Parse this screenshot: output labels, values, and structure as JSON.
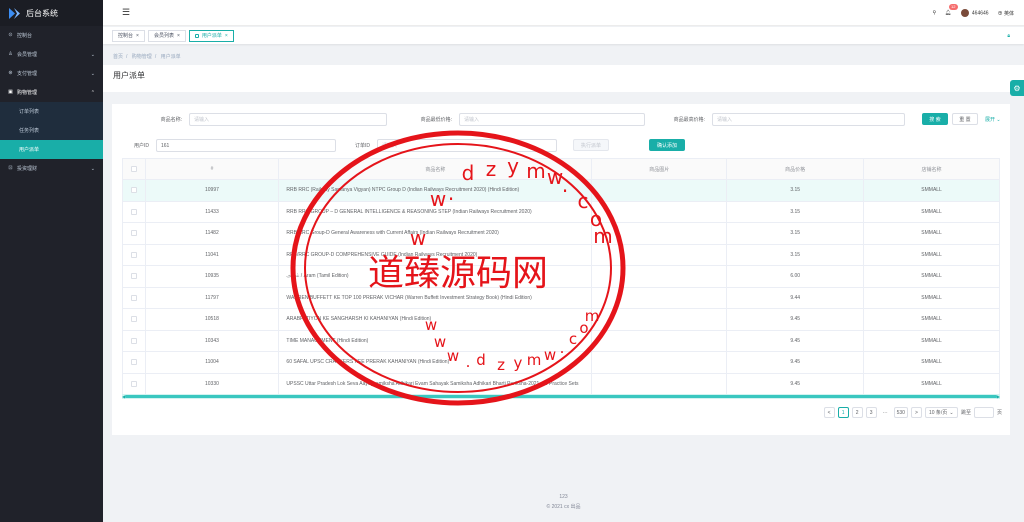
{
  "app": {
    "title": "后台系统"
  },
  "sidebar": {
    "items": [
      {
        "label": "控制台",
        "icon": "home-icon"
      },
      {
        "label": "会员管理",
        "icon": "user-icon",
        "arrow": "⌄"
      },
      {
        "label": "支付管理",
        "icon": "pay-icon",
        "arrow": "⌄"
      },
      {
        "label": "购物管理",
        "icon": "cart-icon",
        "arrow": "⌃"
      },
      {
        "label": "投资理财",
        "icon": "invest-icon",
        "arrow": "⌄"
      }
    ],
    "sub_items": [
      {
        "label": "订单列表"
      },
      {
        "label": "任务列表"
      },
      {
        "label": "用户派单"
      }
    ]
  },
  "header": {
    "menu_icon": "☰",
    "search_icon": "⚲",
    "bell_icon": "🔔",
    "notification_count": "12",
    "username": "464646",
    "lang_label": "英体"
  },
  "tabs": [
    {
      "label": "控制台"
    },
    {
      "label": "会员列表"
    },
    {
      "label": "用户派单"
    }
  ],
  "breadcrumb": {
    "home": "首页",
    "parent": "购物管理",
    "current": "用户派单"
  },
  "page": {
    "title": "用户派单"
  },
  "filters": {
    "name_label": "商品名称:",
    "name_placeholder": "请输入",
    "min_price_label": "商品最低价格:",
    "min_price_placeholder": "请输入",
    "max_price_label": "商品最高价格:",
    "max_price_placeholder": "请输入",
    "search_button": "搜 索",
    "reset_button": "重 置",
    "expand_link": "展开",
    "user_id_label": "用户ID",
    "user_id_value": "161",
    "order_id_label": "订单ID",
    "order_id_placeholder": "请输入",
    "dispatch_button": "执行派单",
    "confirm_button": "确认添加"
  },
  "table": {
    "headers": [
      "#",
      "商品名称",
      "商品图片",
      "商品价格",
      "店铺名称"
    ],
    "rows": [
      {
        "id": "10997",
        "name": "RRB RRC (Railway Samanya Vigyan) NTPC Group D (Indian Railways Recruitment 2020) (Hindi Edition)",
        "price": "3.15",
        "shop": "SMMALL"
      },
      {
        "id": "11433",
        "name": "RRB RRC GROUP – D GENERAL INTELLIGENCE & REASONING STEP (Indian Railways Recruitment 2020)",
        "price": "3.15",
        "shop": "SMMALL"
      },
      {
        "id": "11482",
        "name": "RRB/RRC Group-D General Awareness with Current Affairs (Indian Railways Recruitment 2020)",
        "price": "3.15",
        "shop": "SMMALL"
      },
      {
        "id": "11041",
        "name": "RRB/RRC GROUP-D COMPREHENSIVE GUIDE (Indian Railways Recruitment 2020)",
        "price": "3.15",
        "shop": "SMMALL"
      },
      {
        "id": "10935",
        "name": "அறம் / Aram (Tamil Edition)",
        "price": "6.00",
        "shop": "SMMALL"
      },
      {
        "id": "11797",
        "name": "WARREN BUFFETT KE TOP 100 PRERAK VICHAR (Warren Buffett Investment Strategy Book) (Hindi Edition)",
        "price": "9.44",
        "shop": "SMMALL"
      },
      {
        "id": "10518",
        "name": "ARABPATIYON KE SANGHARSH KI KAHANIYAN (Hindi Edition)",
        "price": "9.45",
        "shop": "SMMALL"
      },
      {
        "id": "10343",
        "name": "TIME MANAGEMENT (Hindi Edition)",
        "price": "9.45",
        "shop": "SMMALL"
      },
      {
        "id": "11004",
        "name": "60 SAFAL UPSC CRACKERS KEE PRERAK KAHANIYAN (Hindi Edition)",
        "price": "9.45",
        "shop": "SMMALL"
      },
      {
        "id": "10330",
        "name": "UPSSC Uttar Pradesh Lok Seva Aayogsamiksha Adhikari Evam Sahayak Samiksha Adhikari Bharti Pariksha-2021, 15 Practice Sets",
        "price": "9.45",
        "shop": "SMMALL"
      }
    ]
  },
  "pagination": {
    "prev": "<",
    "pages": [
      "1",
      "2",
      "3"
    ],
    "ellipsis": "···",
    "last": "530",
    "next": ">",
    "page_size": "10 条/页",
    "goto_label": "跳至",
    "page_unit": "页"
  },
  "footer": {
    "line1": "123",
    "line2": "© 2021 cx 出品"
  },
  "watermark": {
    "main": "道臻源码网",
    "top_letters": [
      "w",
      ".",
      "d",
      "z",
      "y",
      "m",
      "w",
      ".",
      "c",
      "o",
      "m"
    ],
    "left_top": "w",
    "bottom_letters": [
      "w",
      "w",
      "w",
      ".",
      "d",
      "z",
      "y",
      "m",
      "w",
      ".",
      "c",
      "o",
      "m"
    ],
    "color": "#e5141a"
  },
  "colors": {
    "accent": "#19aea8",
    "sidebar": "#20222a",
    "badge": "#f56c6c"
  }
}
